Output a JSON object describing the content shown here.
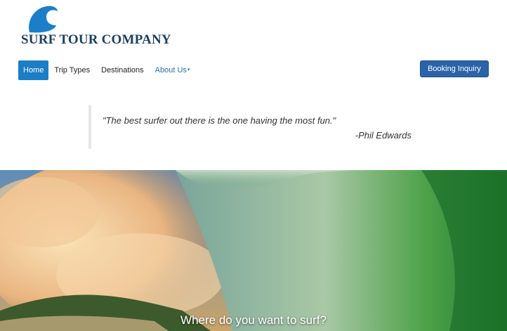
{
  "brand": {
    "name": "SURF TOUR COMPANY",
    "logo_icon": "wave-icon",
    "colors": {
      "wave": "#1c7ec6",
      "text": "#1d3f5e"
    }
  },
  "nav": {
    "items": [
      {
        "label": "Home",
        "active": true
      },
      {
        "label": "Trip Types"
      },
      {
        "label": "Destinations"
      },
      {
        "label": "About Us",
        "dropdown": true,
        "caret": "▾"
      }
    ]
  },
  "booking_button": {
    "label": "Booking Inquiry",
    "color": "#2a64a8"
  },
  "quote": {
    "text": "\"The best surfer out there is the one having the most fun.\"",
    "author": "-Phil Edwards"
  },
  "hero": {
    "caption": "Where do you want to surf?"
  }
}
